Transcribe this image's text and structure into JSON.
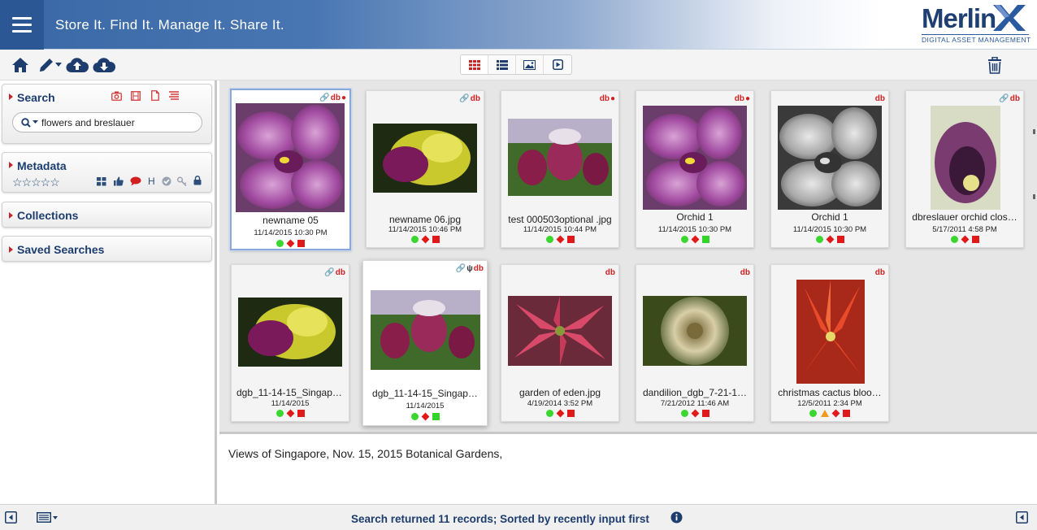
{
  "header": {
    "tagline": "Store It. Find It. Manage It. Share It.",
    "logo_word": "Merlin",
    "logo_sub": "DIGITAL ASSET MANAGEMENT"
  },
  "toolbar": {
    "left_icons": [
      "home-icon",
      "pencil-icon",
      "cloud-upload-icon",
      "cloud-download-icon"
    ],
    "view_modes": [
      "grid-view",
      "list-view",
      "image-view",
      "slideshow-view"
    ],
    "active_view": "grid-view",
    "right_icon": "trash-icon"
  },
  "sidebar": {
    "search": {
      "title": "Search",
      "value": "flowers and breslauer",
      "type_icons": [
        "camera-icon",
        "film-icon",
        "document-icon",
        "text-icon"
      ]
    },
    "metadata": {
      "title": "Metadata",
      "stars": "☆☆☆☆☆",
      "h_label": "H"
    },
    "collections": {
      "title": "Collections"
    },
    "saved_searches": {
      "title": "Saved Searches"
    }
  },
  "records": [
    {
      "name": "newname 05",
      "date": "11/14/2015 10:30 PM",
      "badges": [
        "link",
        "db",
        "comment"
      ],
      "status": [
        "dot",
        "diamond",
        "sq"
      ],
      "selected": true
    },
    {
      "name": "newname 06.jpg",
      "date": "11/14/2015 10:46 PM",
      "badges": [
        "link",
        "db"
      ],
      "status": [
        "dot",
        "diamond",
        "sq"
      ]
    },
    {
      "name": "test 000503optional .jpg",
      "date": "11/14/2015 10:44 PM",
      "badges": [
        "db",
        "comment"
      ],
      "status": [
        "dot",
        "diamond",
        "sq"
      ]
    },
    {
      "name": "Orchid 1",
      "date": "11/14/2015 10:30 PM",
      "badges": [
        "db",
        "comment"
      ],
      "status": [
        "dot",
        "diamond",
        "sq-green"
      ]
    },
    {
      "name": "Orchid 1",
      "date": "11/14/2015 10:30 PM",
      "badges": [
        "db"
      ],
      "status": [
        "dot",
        "diamond",
        "sq"
      ]
    },
    {
      "name": "dbreslauer orchid clos…",
      "date": "5/17/2011 4:58 PM",
      "badges": [
        "link",
        "db"
      ],
      "status": [
        "dot",
        "diamond",
        "sq"
      ]
    },
    {
      "name": "dgb_11-14-15_Singapo…",
      "date": "11/14/2015",
      "badges": [
        "link",
        "db"
      ],
      "status": [
        "dot",
        "diamond",
        "sq"
      ]
    },
    {
      "name": "dgb_11-14-15_Singap…",
      "date": "11/14/2015",
      "badges": [
        "link",
        "psi",
        "db"
      ],
      "status": [
        "dot",
        "diamond",
        "sq-green"
      ],
      "raised": true
    },
    {
      "name": "garden of eden.jpg",
      "date": "4/19/2014 3:52 PM",
      "badges": [
        "db"
      ],
      "status": [
        "dot",
        "diamond",
        "sq"
      ]
    },
    {
      "name": "dandilion_dgb_7-21-1…",
      "date": "7/21/2012 11:46 AM",
      "badges": [
        "db"
      ],
      "status": [
        "dot",
        "diamond",
        "sq"
      ]
    },
    {
      "name": "christmas cactus bloo…",
      "date": "12/5/2011 2:34 PM",
      "badges": [
        "db"
      ],
      "status": [
        "dot",
        "tri",
        "diamond",
        "sq"
      ]
    }
  ],
  "description": "Views of Singapore, Nov. 15, 2015 Botanical Gardens,",
  "statusbar": {
    "text": "Search returned 11 records; Sorted by recently input first"
  },
  "colors": {
    "header_blue": "#3a68a6",
    "nav_text": "#1c3d6e",
    "badge_red": "#d21f1f",
    "status_green": "#3bd62f",
    "status_red": "#e01a1a"
  }
}
